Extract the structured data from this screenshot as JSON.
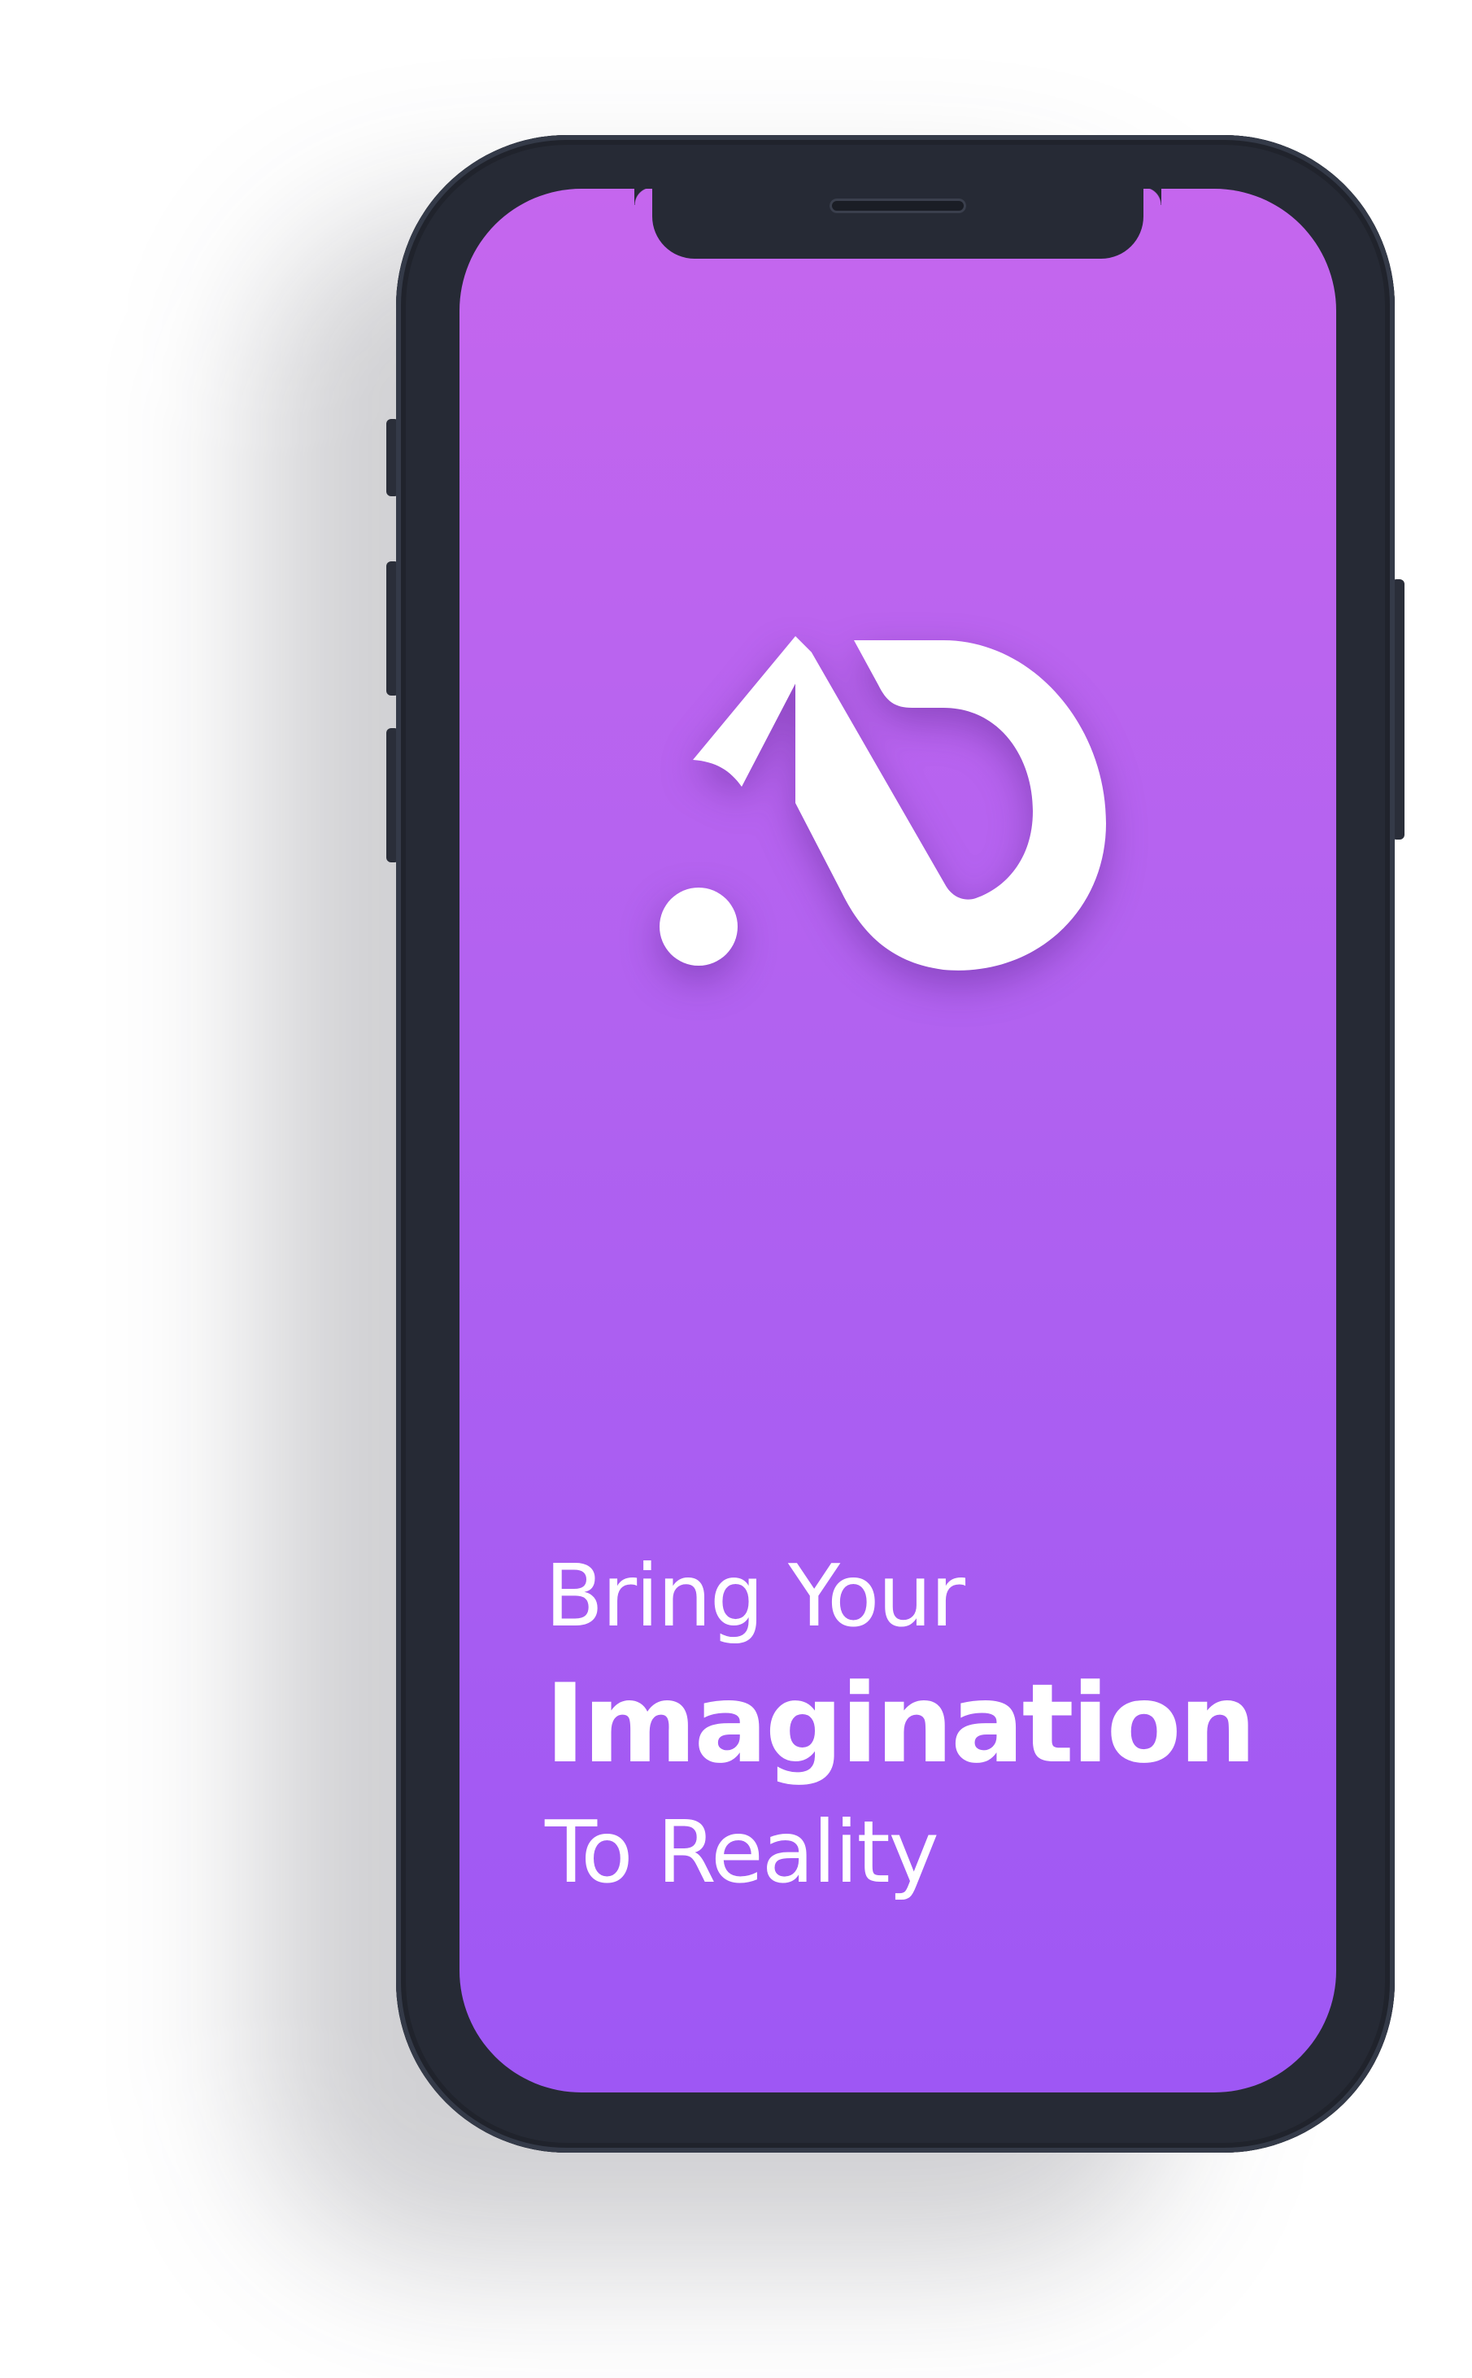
{
  "screen": {
    "gradient_top": "#c566ee",
    "gradient_bottom": "#9e57f4",
    "logo": {
      "icon": "ad-monogram-logo-icon",
      "color": "#ffffff"
    },
    "tagline": {
      "line1": "Bring Your",
      "line2": "Imagination",
      "line3": "To Reality"
    }
  },
  "device": {
    "frame_color": "#262a35"
  }
}
